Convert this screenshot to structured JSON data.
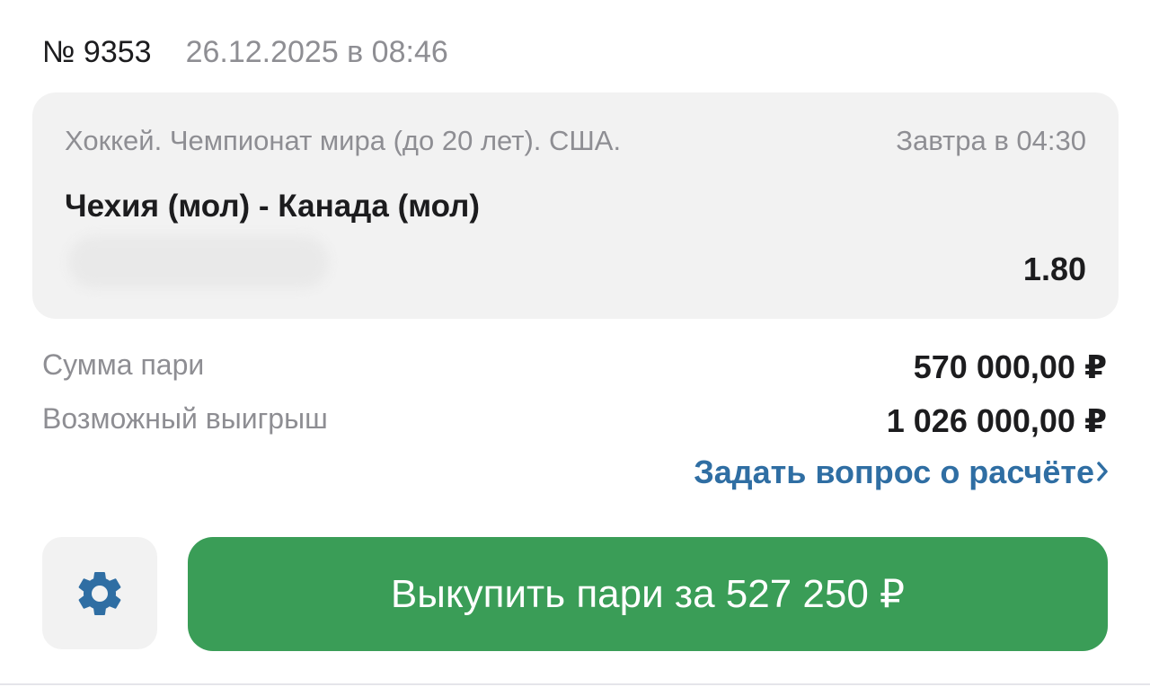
{
  "header": {
    "bet_number": "№ 9353",
    "bet_date": "26.12.2025 в 08:46"
  },
  "event": {
    "tournament": "Хоккей. Чемпионат мира (до 20 лет). США.",
    "start_time": "Завтра в 04:30",
    "match": "Чехия (мол) - Канада (мол)",
    "odds": "1.80"
  },
  "summary": {
    "stake_label": "Сумма пари",
    "stake_value": "570 000,00 ₽",
    "win_label": "Возможный выигрыш",
    "win_value": "1 026 000,00 ₽"
  },
  "actions": {
    "ask_link": "Задать вопрос о расчёте",
    "cashout_label": "Выкупить пари за  527 250 ₽",
    "settings_icon": "gear-icon"
  },
  "colors": {
    "accent_green": "#3a9d57",
    "link_blue": "#2f6ea3",
    "card_bg": "#f2f2f2",
    "muted_text": "#8e8e93"
  }
}
